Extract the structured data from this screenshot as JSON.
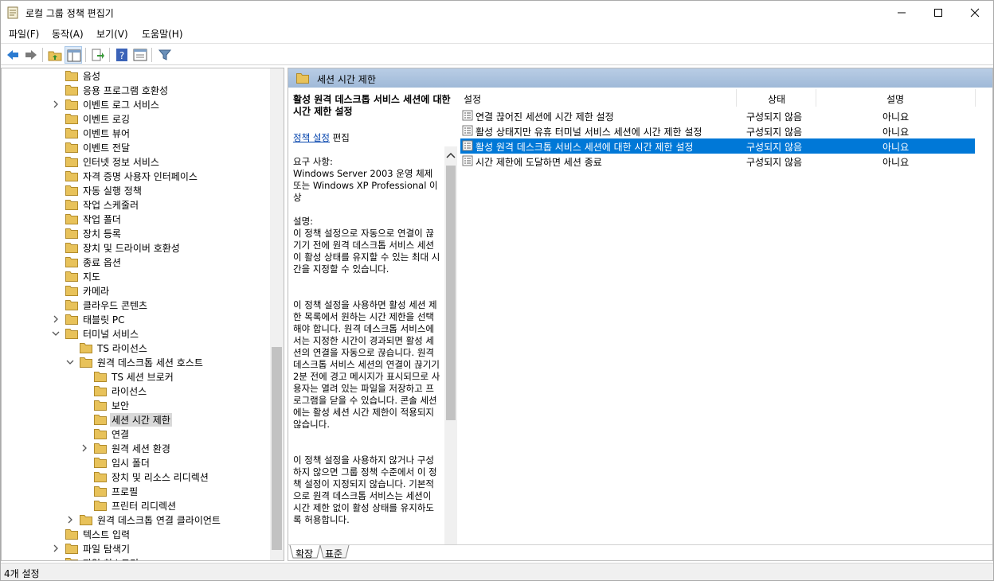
{
  "window": {
    "title": "로컬 그룹 정책 편집기",
    "controls": {
      "minimize": "minimize-icon",
      "maximize": "maximize-icon",
      "close": "close-icon"
    }
  },
  "menu": [
    "파일(F)",
    "동작(A)",
    "보기(V)",
    "도움말(H)"
  ],
  "toolbar": [
    "back-arrow-icon",
    "forward-arrow-icon",
    "up-folder-icon",
    "show-hide-tree-icon",
    "export-list-icon",
    "help-icon",
    "properties-icon",
    "filter-icon"
  ],
  "tree": {
    "items": [
      {
        "label": "음성",
        "expander": ""
      },
      {
        "label": "응용 프로그램 호환성",
        "expander": ""
      },
      {
        "label": "이벤트 로그 서비스",
        "expander": "collapsed"
      },
      {
        "label": "이벤트 로깅",
        "expander": ""
      },
      {
        "label": "이벤트 뷰어",
        "expander": ""
      },
      {
        "label": "이벤트 전달",
        "expander": ""
      },
      {
        "label": "인터넷 정보 서비스",
        "expander": ""
      },
      {
        "label": "자격 증명 사용자 인터페이스",
        "expander": ""
      },
      {
        "label": "자동 실행 정책",
        "expander": ""
      },
      {
        "label": "작업 스케줄러",
        "expander": ""
      },
      {
        "label": "작업 폴더",
        "expander": ""
      },
      {
        "label": "장치 등록",
        "expander": ""
      },
      {
        "label": "장치 및 드라이버 호환성",
        "expander": ""
      },
      {
        "label": "종료 옵션",
        "expander": ""
      },
      {
        "label": "지도",
        "expander": ""
      },
      {
        "label": "카메라",
        "expander": ""
      },
      {
        "label": "클라우드 콘텐츠",
        "expander": ""
      },
      {
        "label": "태블릿 PC",
        "expander": "collapsed"
      },
      {
        "label": "터미널 서비스",
        "expander": "expanded"
      },
      {
        "label": "TS 라이선스",
        "expander": ""
      },
      {
        "label": "원격 데스크톱 세션 호스트",
        "expander": "expanded"
      },
      {
        "label": "TS 세션 브로커",
        "expander": ""
      },
      {
        "label": "라이선스",
        "expander": ""
      },
      {
        "label": "보안",
        "expander": ""
      },
      {
        "label": "세션 시간 제한",
        "expander": "",
        "selected": true
      },
      {
        "label": "연결",
        "expander": ""
      },
      {
        "label": "원격 세션 환경",
        "expander": "collapsed"
      },
      {
        "label": "임시 폴더",
        "expander": ""
      },
      {
        "label": "장치 및 리소스 리디렉션",
        "expander": ""
      },
      {
        "label": "프로필",
        "expander": ""
      },
      {
        "label": "프린터 리디렉션",
        "expander": ""
      },
      {
        "label": "원격 데스크톱 연결 클라이언트",
        "expander": "collapsed"
      },
      {
        "label": "텍스트 입력",
        "expander": ""
      },
      {
        "label": "파일 탐색기",
        "expander": "collapsed"
      },
      {
        "label": "파일 히스토리",
        "expander": ""
      }
    ]
  },
  "pane_header": "세션 시간 제한",
  "description": {
    "title": "활성 원격 데스크톱 서비스 세션에 대한 시간 제한 설정",
    "edit_link": "정책 설정",
    "edit_suffix": " 편집",
    "req_label": "요구 사항:",
    "req_text": "Windows Server 2003 운영 체제 또는 Windows XP Professional 이상",
    "desc_label": "설명:",
    "p1": "이 정책 설정으로 자동으로 연결이 끊기기 전에 원격 데스크톱 서비스 세션이 활성 상태를 유지할 수 있는 최대 시간을 지정할 수 있습니다.",
    "p2": "이 정책 설정을 사용하면 활성 세션 제한 목록에서 원하는 시간 제한을 선택해야 합니다. 원격 데스크톱 서비스에서는 지정한 시간이 경과되면 활성 세션의 연결을 자동으로 끊습니다. 원격 데스크톱 서비스 세션의 연결이 끊기기 2분 전에 경고 메시지가 표시되므로 사용자는 열려 있는 파일을 저장하고 프로그램을 닫을 수 있습니다. 콘솔 세션에는 활성 세션 시간 제한이 적용되지 않습니다.",
    "p3": "이 정책 설정을 사용하지 않거나 구성하지 않으면 그룹 정책 수준에서 이 정책 설정이 지정되지 않습니다. 기본적으로 원격 데스크톱 서비스는 세션이 시간 제한 없이 활성 상태를 유지하도록 허용합니다."
  },
  "columns": {
    "setting": "설정",
    "state": "상태",
    "comment": "설명"
  },
  "rows": [
    {
      "setting": "연결 끊어진 세션에 시간 제한 설정",
      "state": "구성되지 않음",
      "comment": "아니요"
    },
    {
      "setting": "활성 상태지만 유휴 터미널 서비스 세션에 시간 제한 설정",
      "state": "구성되지 않음",
      "comment": "아니요"
    },
    {
      "setting": "활성 원격 데스크톱 서비스 세션에 대한 시간 제한 설정",
      "state": "구성되지 않음",
      "comment": "아니요",
      "selected": true
    },
    {
      "setting": "시간 제한에 도달하면 세션 종료",
      "state": "구성되지 않음",
      "comment": "아니요"
    }
  ],
  "tabs": [
    "확장",
    "표준"
  ],
  "status": "4개 설정",
  "colors": {
    "selection": "#0078d7",
    "header_gradient": "#b9cde5",
    "folder": "#e8c25a"
  }
}
